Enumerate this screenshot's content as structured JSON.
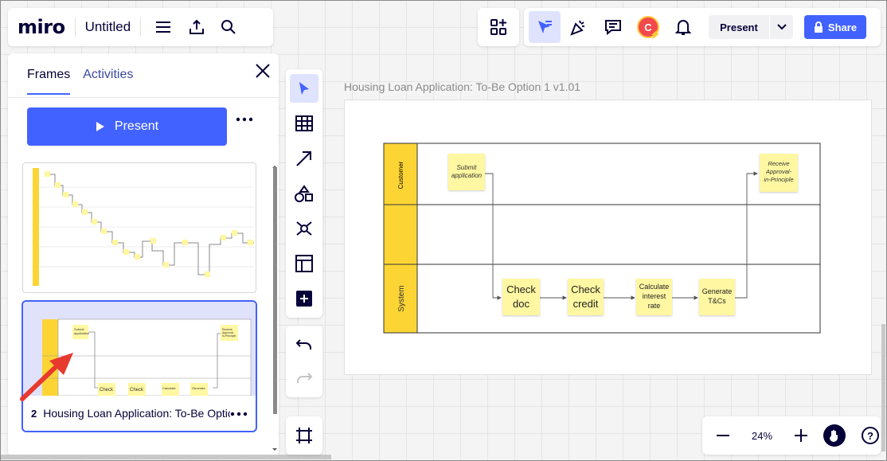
{
  "app": {
    "logo": "miro",
    "board_title": "Untitled"
  },
  "topbar": {
    "present_label": "Present",
    "share_label": "Share",
    "avatar_initial": "C"
  },
  "panel": {
    "tabs": [
      {
        "label": "Frames",
        "active": true
      },
      {
        "label": "Activities",
        "active": false
      }
    ],
    "present_label": "Present",
    "frames": [
      {
        "index": "",
        "title": ""
      },
      {
        "index": "2",
        "title": "Housing Loan Application: To-Be Option 1 v1.01",
        "selected": true
      }
    ]
  },
  "canvas": {
    "frame_title": "Housing Loan Application: To-Be Option 1 v1.01",
    "lanes": [
      "Customer",
      "",
      "System"
    ],
    "stickies": {
      "submit": [
        "Submit",
        "application"
      ],
      "receive": [
        "Receive",
        "Approval-",
        "in-Principle"
      ],
      "check_doc": [
        "Check",
        "doc"
      ],
      "check_credit": [
        "Check",
        "credit"
      ],
      "calc": [
        "Calculate",
        "interest",
        "rate"
      ],
      "generate": [
        "Generate",
        "T&Cs"
      ]
    }
  },
  "zoom": {
    "level": "24%"
  },
  "colors": {
    "accent": "#4262ff",
    "lane_header": "#fcd535",
    "sticky": "#fff7a1",
    "arrow_annotation": "#e8392f"
  }
}
